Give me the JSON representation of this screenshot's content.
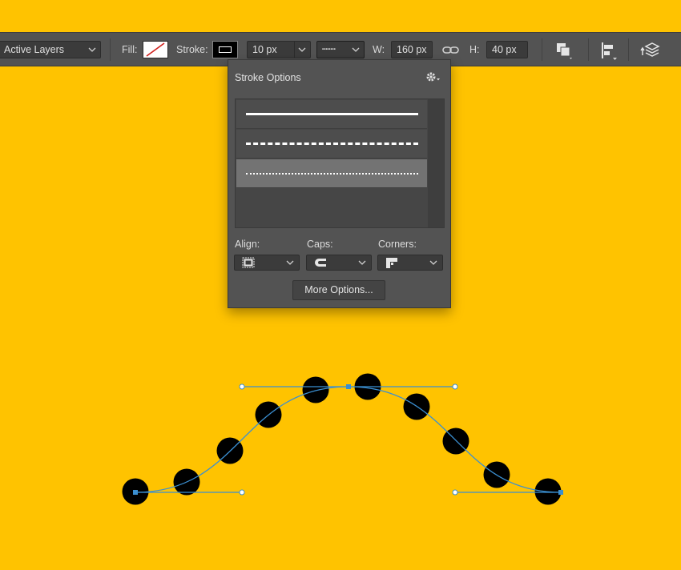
{
  "options_bar": {
    "layers_dropdown": "Active Layers",
    "fill_label": "Fill:",
    "stroke_label": "Stroke:",
    "stroke_width": "10 px",
    "w_label": "W:",
    "w_value": "160 px",
    "h_label": "H:",
    "h_value": "40 px",
    "dash_preview": "••••••••"
  },
  "stroke_options_panel": {
    "title": "Stroke Options",
    "styles": [
      {
        "name": "solid",
        "selected": false
      },
      {
        "name": "dashed",
        "selected": false
      },
      {
        "name": "dotted",
        "selected": true
      }
    ],
    "align_label": "Align:",
    "caps_label": "Caps:",
    "corners_label": "Corners:",
    "more_options_label": "More Options..."
  },
  "colors": {
    "canvas_bg": "#FFC300",
    "path_color": "#3B8FD1",
    "dot_color": "#000000",
    "panel_bg": "#535353"
  },
  "icons": [
    "chevron-down-icon",
    "link-icon",
    "path-operations-icon",
    "path-alignment-icon",
    "path-arrangement-icon",
    "gear-icon",
    "align-inside-icon",
    "round-cap-icon",
    "miter-corner-icon"
  ]
}
